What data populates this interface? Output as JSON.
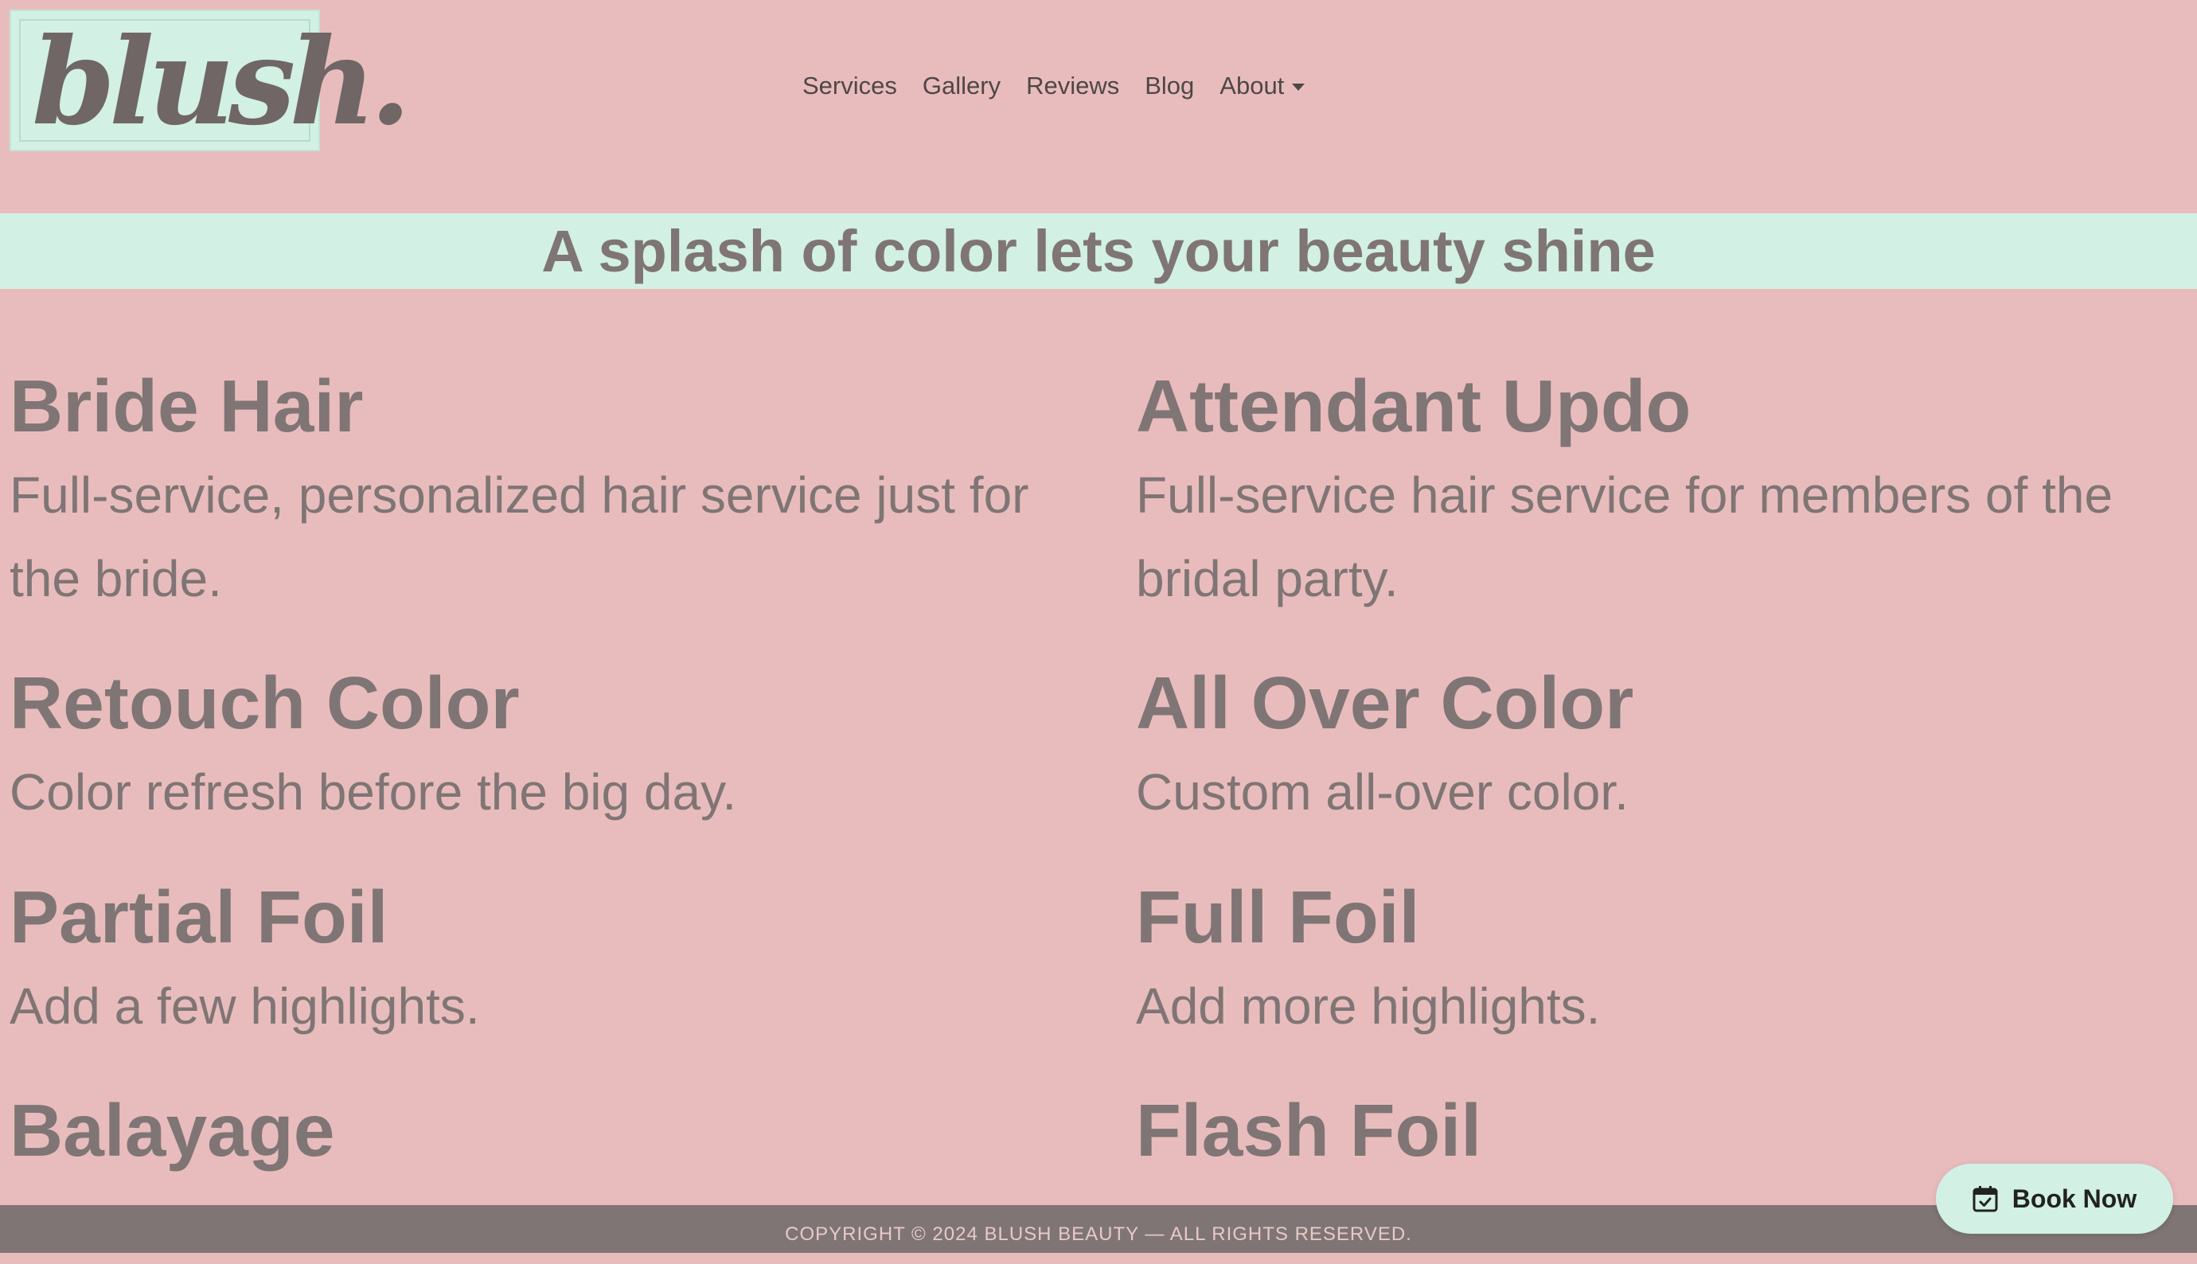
{
  "logo": {
    "text": "blush."
  },
  "nav": {
    "items": [
      "Services",
      "Gallery",
      "Reviews",
      "Blog"
    ],
    "about_label": "About"
  },
  "banner": {
    "heading": "A splash of color lets your beauty shine"
  },
  "services": [
    {
      "title": "Bride Hair",
      "description": "Full-service, personalized hair service just for the bride."
    },
    {
      "title": "Attendant Updo",
      "description": "Full-service hair service for members of the bridal party."
    },
    {
      "title": "Retouch Color",
      "description": "Color refresh before the big day."
    },
    {
      "title": "All Over Color",
      "description": "Custom all-over color."
    },
    {
      "title": "Partial Foil",
      "description": "Add a few highlights."
    },
    {
      "title": "Full Foil",
      "description": "Add more highlights."
    },
    {
      "title": "Balayage",
      "description": ""
    },
    {
      "title": "Flash Foil",
      "description": ""
    }
  ],
  "footer": {
    "text": "COPYRIGHT © 2024 BLUSH BEAUTY — ALL RIGHTS RESERVED."
  },
  "book_button": {
    "label": "Book Now",
    "icon": "calendar-check-icon"
  },
  "colors": {
    "background": "#e8bcbd",
    "accent": "#d2f0e4",
    "text": "#7f7574",
    "footer": "#7f7574"
  }
}
